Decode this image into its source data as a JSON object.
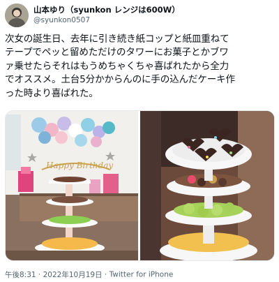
{
  "user": {
    "display_name": "山本ゆり（syunkon レンジは600W）",
    "handle": "@syunkon0507",
    "avatar_icon": "profile-photo"
  },
  "tweet": {
    "lines": [
      "次女の誕生日、去年に引き続き紙コップと紙皿重ねて",
      "テープでペッと留めただけのタワーにお菓子とかブワ",
      "ァ乗せたらそれはもうめちゃくちゃ喜ばれたから全力",
      "でオススメ。土台5分かからんのに手の込んだケーキ作",
      "った時より喜ばれた。"
    ]
  },
  "media": {
    "banner_text": "Happy Birthday"
  },
  "footer": {
    "time": "午後8:31",
    "separator1": " · ",
    "date": "2022年10月19日",
    "separator2": " · ",
    "source": "Twitter for iPhone"
  }
}
